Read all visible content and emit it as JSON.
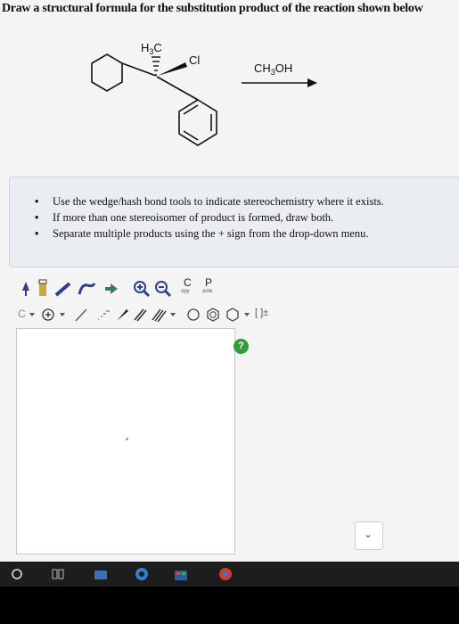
{
  "question": {
    "text": "Draw a structural formula for the substitution product of the reaction shown below"
  },
  "scheme": {
    "methyl_label": "H3C",
    "methyl_h": "H",
    "methyl_sub": "3",
    "methyl_c": "C",
    "chloro_label": "Cl",
    "reagent_label": "CH3OH",
    "reagent_ch": "CH",
    "reagent_sub": "3",
    "reagent_oh": "OH"
  },
  "instructions": {
    "items": [
      "Use the wedge/hash bond tools to indicate stereochemistry where it exists.",
      "If more than one stereoisomer of product is formed, draw both.",
      "Separate multiple products using the + sign from the drop-down menu."
    ]
  },
  "toolbar": {
    "copy_letter": "C",
    "copy_sub": "opy",
    "paste_letter": "P",
    "paste_sub": "aste",
    "charge_label": "C",
    "bracket_label": "[ ]±"
  },
  "help": {
    "label": "?"
  },
  "dropdown": {
    "arrow": "⌄"
  },
  "taskbar": {
    "icons": [
      "windows-start-icon",
      "task-view-icon",
      "file-explorer-icon",
      "edge-browser-icon",
      "store-icon",
      "chrome-icon"
    ]
  },
  "colors": {
    "page_bg": "#f4f4f4",
    "instructions_bg": "#eaedf1",
    "help_green": "#2e9e3a",
    "taskbar_bg": "#1d1d1d",
    "tool_blue": "#2e3f8f"
  }
}
